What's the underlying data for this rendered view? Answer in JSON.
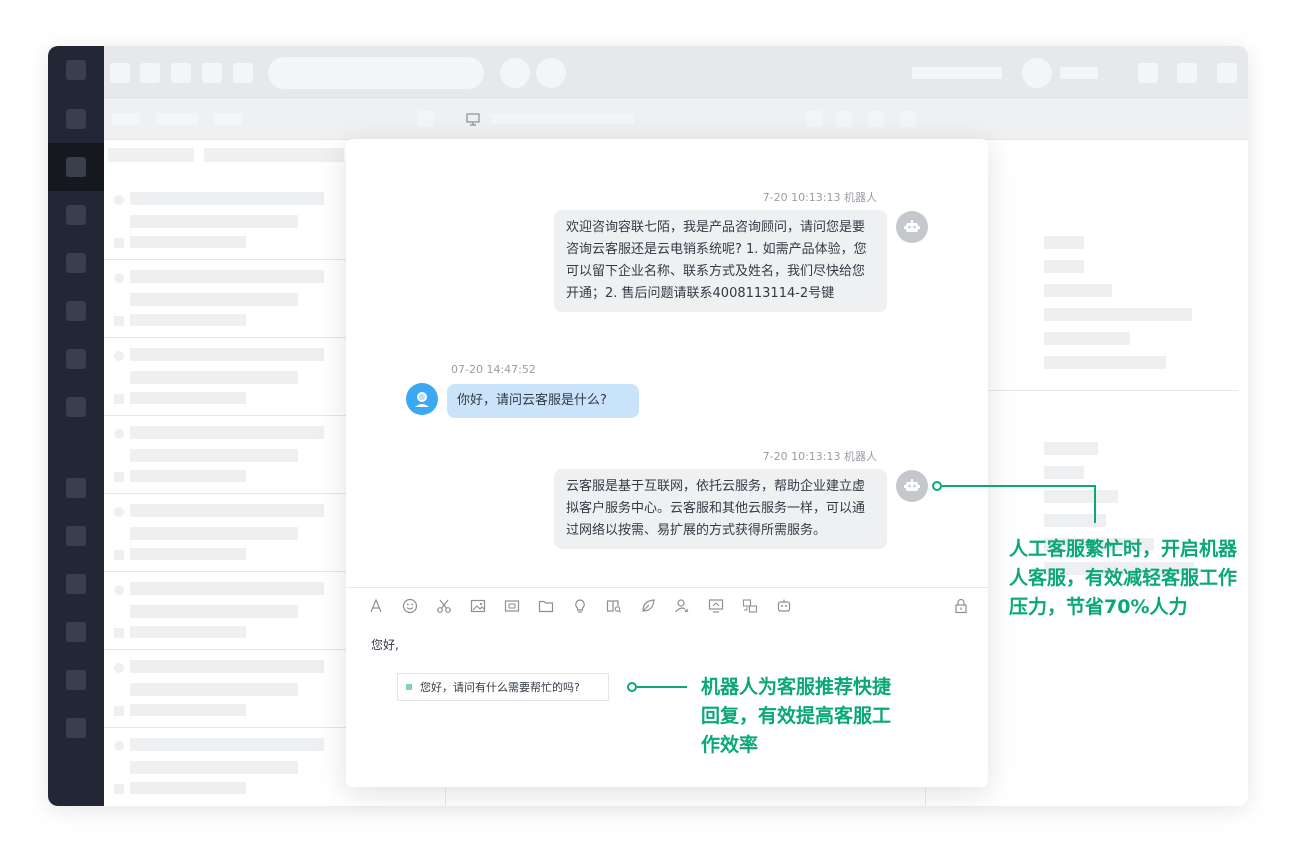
{
  "chat": {
    "messages": [
      {
        "meta": "7-20 10:13:13 机器人",
        "text": "欢迎咨询容联七陌，我是产品咨询顾问，请问您是要咨询云客服还是云电销系统呢? 1. 如需产品体验，您可以留下企业名称、联系方式及姓名，我们尽快给您开通；2. 售后问题请联系4008113114-2号键",
        "sender": "robot"
      },
      {
        "meta": "07-20 14:47:52",
        "text": "你好，请问云客服是什么?",
        "sender": "user"
      },
      {
        "meta": "7-20 10:13:13 机器人",
        "text": "云客服是基于互联网，依托云服务，帮助企业建立虚拟客户服务中心。云客服和其他云服务一样，可以通过网络以按需、易扩展的方式获得所需服务。",
        "sender": "robot"
      }
    ],
    "toolbar_icons": [
      "font-icon",
      "emoji-icon",
      "scissors-icon",
      "image-icon",
      "video-icon",
      "folder-icon",
      "bulb-icon",
      "book-search-icon",
      "leaf-icon",
      "user-transfer-icon",
      "screen-share-icon",
      "remote-icon",
      "robot-icon",
      "lock-icon"
    ],
    "input_value": "您好,",
    "suggestion": "您好，请问有什么需要帮忙的吗?"
  },
  "annotations": {
    "right": "人工客服繁忙时，开启机器人客服，有效减轻客服工作压力，节省70%人力",
    "bottom": "机器人为客服推荐快捷回复，有效提高客服工作效率"
  },
  "colors": {
    "accent": "#0aa878",
    "sidebar": "#232735",
    "user_bubble": "#c9e3fb",
    "bot_bubble": "#eff0f2"
  }
}
